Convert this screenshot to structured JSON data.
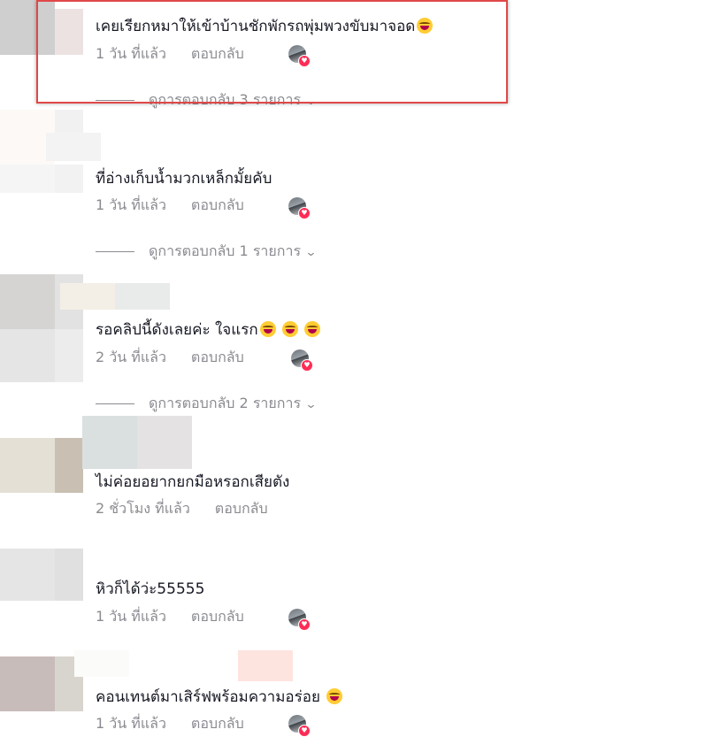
{
  "comments": [
    {
      "text": "เคยเรียกหมาให้เข้าบ้านชักพักรถพุ่มพวงขับมาจอด",
      "emoji": "laughing-face",
      "time": "1 วัน ที่แล้ว",
      "reply": "ตอบกลับ",
      "replies": "ดูการตอบกลับ 3 รายการ"
    },
    {
      "text": "ที่อ่างเก็บน้ำมวกเหล็กมั้ยคับ",
      "time": "1 วัน ที่แล้ว",
      "reply": "ตอบกลับ",
      "replies": "ดูการตอบกลับ 1 รายการ"
    },
    {
      "text": "รอคลิปนี้ดังเลยค่ะ ใจแรก",
      "time": "2 วัน ที่แล้ว",
      "reply": "ตอบกลับ",
      "replies": "ดูการตอบกลับ 2 รายการ"
    },
    {
      "text": "ไม่ค่อยอยากยกมือหรอกเสียตัง",
      "time": "2 ชั่วโมง ที่แล้ว",
      "reply": "ตอบกลับ"
    },
    {
      "text": "หิวก็ได้ว่ะ55555",
      "time": "1 วัน ที่แล้ว",
      "reply": "ตอบกลับ"
    },
    {
      "text": "คอนเทนต์มาเสิร์ฟพร้อมความอร่อย",
      "time": "1 วัน ที่แล้ว",
      "reply": "ตอบกลับ"
    }
  ],
  "colors": {
    "highlight": "#e04848",
    "like": "#fe2c55",
    "meta": "#8a8b91"
  }
}
